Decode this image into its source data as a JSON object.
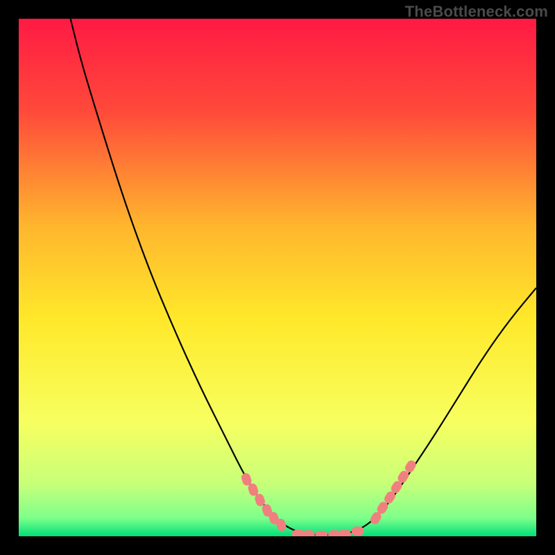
{
  "watermark": "TheBottleneck.com",
  "chart_data": {
    "type": "line",
    "title": "",
    "xlabel": "",
    "ylabel": "",
    "xlim": [
      0,
      100
    ],
    "ylim": [
      0,
      100
    ],
    "grid": false,
    "legend": false,
    "gradient_stops": [
      {
        "offset": 0.0,
        "color": "#ff1a44"
      },
      {
        "offset": 0.18,
        "color": "#ff4a3a"
      },
      {
        "offset": 0.4,
        "color": "#ffb62e"
      },
      {
        "offset": 0.58,
        "color": "#ffe82a"
      },
      {
        "offset": 0.78,
        "color": "#f7ff60"
      },
      {
        "offset": 0.9,
        "color": "#c7ff7a"
      },
      {
        "offset": 0.965,
        "color": "#7dff8a"
      },
      {
        "offset": 1.0,
        "color": "#00e07a"
      }
    ],
    "series": [
      {
        "name": "curve",
        "color": "#000000",
        "points": [
          {
            "x": 10.0,
            "y": 100.0
          },
          {
            "x": 12.0,
            "y": 92.0
          },
          {
            "x": 15.0,
            "y": 82.0
          },
          {
            "x": 20.0,
            "y": 66.0
          },
          {
            "x": 25.0,
            "y": 52.0
          },
          {
            "x": 30.0,
            "y": 40.0
          },
          {
            "x": 35.0,
            "y": 29.0
          },
          {
            "x": 40.0,
            "y": 19.0
          },
          {
            "x": 44.0,
            "y": 11.0
          },
          {
            "x": 48.0,
            "y": 5.0
          },
          {
            "x": 52.0,
            "y": 1.5
          },
          {
            "x": 56.0,
            "y": 0.3
          },
          {
            "x": 60.0,
            "y": 0.2
          },
          {
            "x": 64.0,
            "y": 0.5
          },
          {
            "x": 68.0,
            "y": 2.5
          },
          {
            "x": 72.0,
            "y": 7.0
          },
          {
            "x": 76.0,
            "y": 13.0
          },
          {
            "x": 80.0,
            "y": 19.0
          },
          {
            "x": 85.0,
            "y": 27.0
          },
          {
            "x": 90.0,
            "y": 35.0
          },
          {
            "x": 95.0,
            "y": 42.0
          },
          {
            "x": 100.0,
            "y": 48.0
          }
        ]
      },
      {
        "name": "left-band-markers",
        "color": "#f08080",
        "marker": "pill",
        "points": [
          {
            "x": 44.0,
            "y": 11.0
          },
          {
            "x": 45.3,
            "y": 9.0
          },
          {
            "x": 46.6,
            "y": 7.0
          },
          {
            "x": 48.0,
            "y": 5.0
          },
          {
            "x": 49.3,
            "y": 3.5
          },
          {
            "x": 50.7,
            "y": 2.2
          }
        ]
      },
      {
        "name": "bottom-markers",
        "color": "#f08080",
        "marker": "pill",
        "points": [
          {
            "x": 54.0,
            "y": 0.4
          },
          {
            "x": 56.0,
            "y": 0.3
          },
          {
            "x": 58.5,
            "y": 0.2
          },
          {
            "x": 61.0,
            "y": 0.3
          },
          {
            "x": 63.0,
            "y": 0.4
          },
          {
            "x": 65.5,
            "y": 1.0
          }
        ]
      },
      {
        "name": "right-band-markers",
        "color": "#f08080",
        "marker": "pill",
        "points": [
          {
            "x": 69.0,
            "y": 3.5
          },
          {
            "x": 70.3,
            "y": 5.5
          },
          {
            "x": 71.7,
            "y": 7.5
          },
          {
            "x": 73.0,
            "y": 9.5
          },
          {
            "x": 74.3,
            "y": 11.5
          },
          {
            "x": 75.7,
            "y": 13.5
          }
        ]
      }
    ]
  }
}
